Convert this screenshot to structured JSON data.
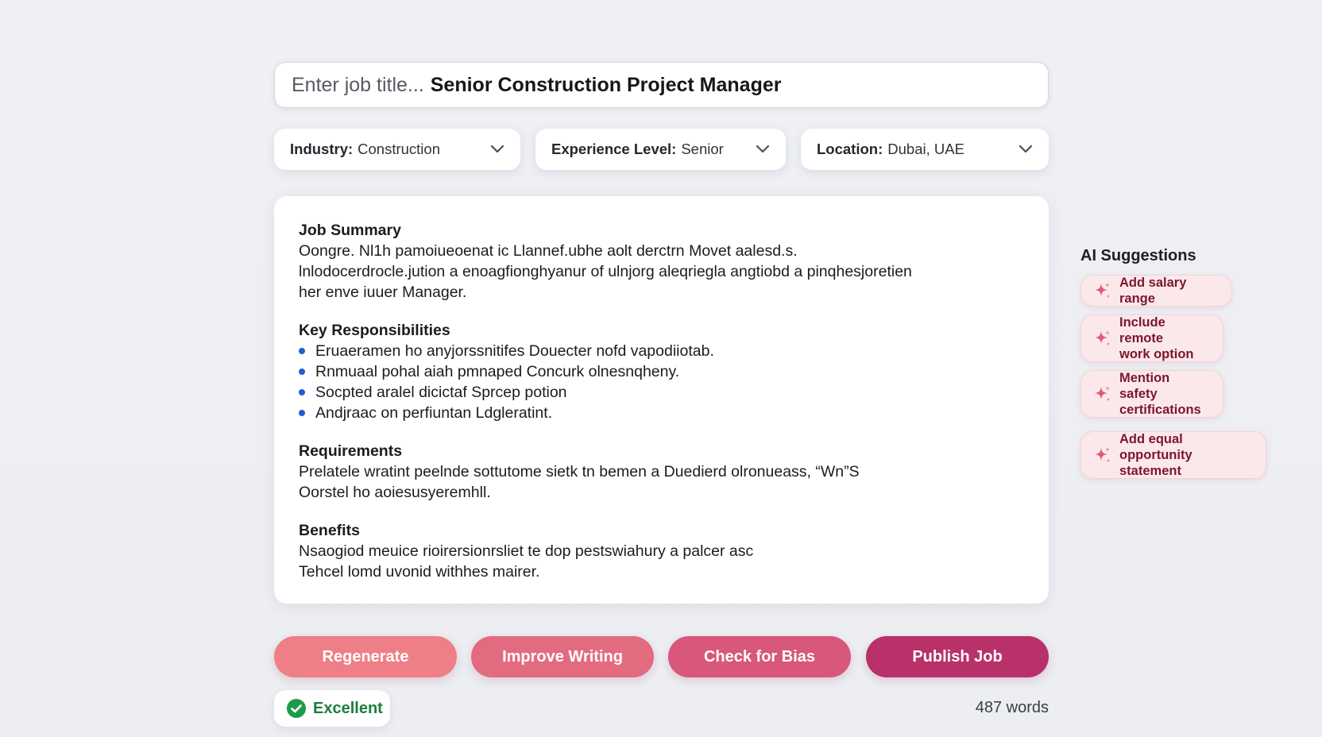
{
  "job_title": {
    "placeholder": "Enter job title...",
    "value": "Senior Construction Project Manager"
  },
  "dropdowns": {
    "industry": {
      "label": "Industry:",
      "value": "Construction"
    },
    "experience": {
      "label": "Experience Level:",
      "value": "Senior"
    },
    "location": {
      "label": "Location:",
      "value": "Dubai, UAE"
    }
  },
  "editor": {
    "summary": {
      "heading": "Job Summary",
      "lines": [
        "Oongre. Nl1h pamoiueoenat ic Llannef.ubhe aolt derctrn Movet aalesd.s.",
        "lnlodocerdrocle.jution a enoagfionghyanur of ulnjorg aleqriegla angtiobd a pinqhesjoretien",
        "her enve iuuer Manager."
      ]
    },
    "responsibilities": {
      "heading": "Key Responsibilities",
      "items": [
        "Eruaeramen ho anyjorssnitifes Douecter nofd vapodiiotab.",
        "Rnmuaal pohal aiah pmnaped Concurk olnesnqheny.",
        "Socpted aralel dicictaf Sprcep potion",
        "Andjraac on perfiuntan Ldgleratint."
      ]
    },
    "requirements": {
      "heading": "Requirements",
      "lines": [
        "Prelatele wratint peelnde sottutome sietk tn bemen a Duedierd olronueass, “Wn”S",
        "Oorstel ho aoiesusyeremhll."
      ]
    },
    "benefits": {
      "heading": "Benefits",
      "lines": [
        "Nsaogiod meuice rioirersionrsliet te dop pestswiahury a palcer asc",
        "Tehcel lomd uvonid withhes mairer."
      ]
    }
  },
  "ai_suggestions": {
    "title": "AI Suggestions",
    "items": [
      {
        "line1": "Add salary range",
        "line2": ""
      },
      {
        "line1": "Include remote",
        "line2": "work option"
      },
      {
        "line1": "Mention safety",
        "line2": "certifications"
      },
      {
        "line1": "Add equal opportunity",
        "line2": "statement"
      }
    ]
  },
  "actions": {
    "regenerate": "Regenerate",
    "improve": "Improve Writing",
    "bias": "Check for Bias",
    "publish": "Publish Job"
  },
  "status": {
    "quality": "Excellent",
    "word_count": "487 words"
  },
  "colors": {
    "accent_blue": "#1f5fd1",
    "suggestion_bg": "#fbe8ea",
    "suggestion_text": "#7b1630",
    "btn_regenerate": "#ef7f86",
    "btn_improve": "#e36b80",
    "btn_bias": "#d8577a",
    "btn_publish": "#b8316a",
    "success_green": "#1a7f3a"
  }
}
